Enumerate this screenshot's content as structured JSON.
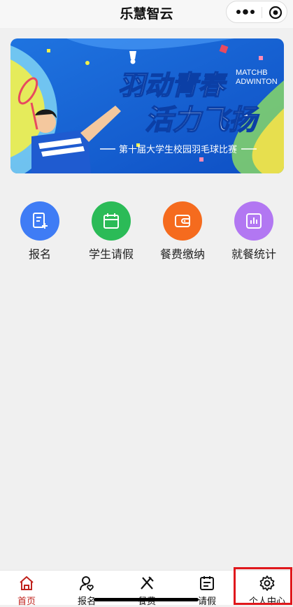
{
  "app": {
    "title": "乐慧智云"
  },
  "banner": {
    "headline_1": "羽动青春",
    "headline_2": "活力飞扬",
    "en_1": "MATCHB",
    "en_2": "ADWINTON",
    "subtitle": "第十届大学生校园羽毛球比赛"
  },
  "grid": [
    {
      "label": "报名",
      "icon": "form-edit-icon",
      "color": "#3f7cf5"
    },
    {
      "label": "学生请假",
      "icon": "calendar-icon",
      "color": "#2bbb57"
    },
    {
      "label": "餐费缴纳",
      "icon": "wallet-icon",
      "color": "#f56b1e"
    },
    {
      "label": "就餐统计",
      "icon": "bar-chart-icon",
      "color": "#b277f2"
    }
  ],
  "tabs": [
    {
      "label": "首页",
      "icon": "home-icon",
      "active": true
    },
    {
      "label": "报名",
      "icon": "user-heart-icon",
      "active": false
    },
    {
      "label": "餐费",
      "icon": "utensils-icon",
      "active": false
    },
    {
      "label": "请假",
      "icon": "calendar-list-icon",
      "active": false
    },
    {
      "label": "个人中心",
      "icon": "gear-icon",
      "active": false
    }
  ],
  "colors": {
    "active_tab": "#c0231d",
    "highlight": "#e0181c"
  }
}
